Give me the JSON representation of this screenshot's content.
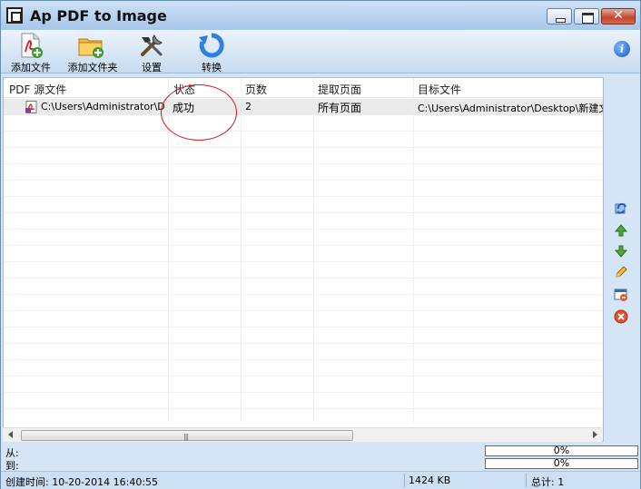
{
  "window": {
    "title": "Ap PDF to Image"
  },
  "toolbar": {
    "items": [
      {
        "label": "添加文件",
        "icon": "add-file-pdf-icon"
      },
      {
        "label": "添加文件夹",
        "icon": "add-folder-icon"
      },
      {
        "label": "设置",
        "icon": "settings-tools-icon"
      },
      {
        "label": "转换",
        "icon": "convert-refresh-icon"
      }
    ],
    "info_label": "i"
  },
  "list": {
    "columns": [
      "PDF 源文件",
      "状态",
      "页数",
      "提取页面",
      "目标文件"
    ],
    "rows": [
      {
        "source": "C:\\Users\\Administrator\\D...",
        "status": "成功",
        "pages": "2",
        "extract": "所有页面",
        "target": "C:\\Users\\Administrator\\Desktop\\新建文件"
      }
    ]
  },
  "scrollbar": {
    "grip": "|||"
  },
  "sidebar": {
    "icons": [
      "refresh-icon",
      "move-up-icon",
      "move-down-icon",
      "edit-pencil-icon",
      "window-remove-icon",
      "delete-icon"
    ]
  },
  "progress": {
    "from_label": "从:",
    "to_label": "到:",
    "from_percent": "0%",
    "to_percent": "0%"
  },
  "status": {
    "created": "创建时间: 10-20-2014 16:40:55",
    "size": "1424 KB",
    "total": "总计: 1"
  },
  "colors": {
    "accent": "#1657c7",
    "annotation": "#d01818",
    "window_bg": "#d6e5f5"
  }
}
